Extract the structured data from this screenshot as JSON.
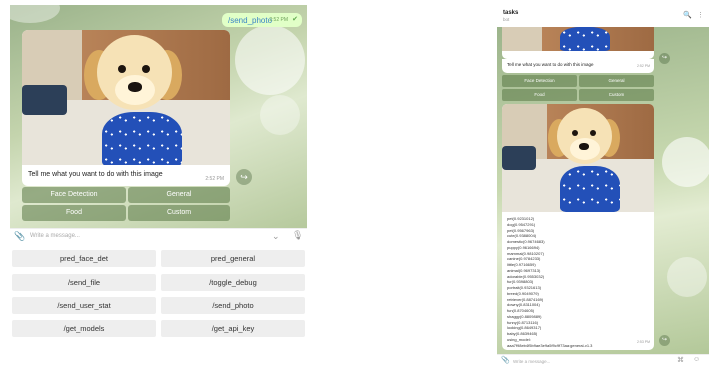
{
  "left": {
    "command_bubble": {
      "text": "/send_photo",
      "time": "2:52 PM",
      "check": "✔"
    },
    "message": {
      "caption": "Tell me what you want to do with this image",
      "time": "2:52 PM"
    },
    "share_icon": "↪",
    "inline_keyboard": [
      "Face Detection",
      "General",
      "Food",
      "Custom"
    ],
    "input": {
      "placeholder": "Write a message...",
      "clip": "📎",
      "chevron": "⌄",
      "mic": "🎙"
    },
    "commands": [
      "pred_face_det",
      "pred_general",
      "/send_file",
      "/toggle_debug",
      "/send_user_stat",
      "/send_photo",
      "/get_models",
      "/get_api_key"
    ]
  },
  "right": {
    "header": {
      "title": "tasks",
      "subtitle": "bot",
      "search": "🔍",
      "menu": "⋮"
    },
    "top_message": {
      "caption": "Tell me what you want to do with this image",
      "time": "2:52 PM"
    },
    "share_icon": "↪",
    "inline_keyboard": [
      "Face Detection",
      "General",
      "Food",
      "Custom"
    ],
    "result_time": "2:53 PM",
    "result_lines": [
      "pet(0.9231012)",
      "dog(0.9547291)",
      "pet(0.9567963)",
      "cute(0.9388004)",
      "domestic(0.9674683)",
      "puppy(0.9616694)",
      "mammal(0.9810207)",
      "canine(0.9784233)",
      "little(0.9716659)",
      "animal(0.9697313)",
      "adorable(0.9553032)",
      "fur(0.9398803)",
      "portrait(0.9321613)",
      "breed(0.9049079)",
      "retriever(0.8874169)",
      "downy(0.8311004)",
      "fun(0.8704605)",
      "shaggy(0.8809889)",
      "funny(0.8713116)",
      "looking(0.8649317)",
      "baby(0.8639465)",
      "using_model:",
      "aaa7f98eb4f5b9ae3e9a5f9c9f73aa:general-v1.3"
    ],
    "input": {
      "placeholder": "Write a message...",
      "clip": "📎",
      "cmd": "⌘",
      "emoji": "☺"
    }
  }
}
